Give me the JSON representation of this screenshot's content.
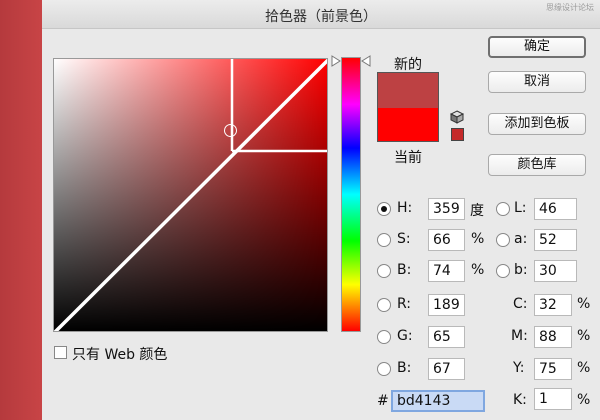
{
  "dialog": {
    "title": "拾色器（前景色）",
    "watermark": "思缘设计论坛"
  },
  "buttons": {
    "ok": "确定",
    "cancel": "取消",
    "add_to_swatches": "添加到色板",
    "color_libraries": "颜色库"
  },
  "preview": {
    "new_label": "新的",
    "current_label": "当前",
    "new_color": "#bd4143",
    "current_color": "#ff0000"
  },
  "hsb": {
    "h": {
      "label": "H:",
      "value": "359",
      "unit": "度",
      "selected": true
    },
    "s": {
      "label": "S:",
      "value": "66",
      "unit": "%"
    },
    "b": {
      "label": "B:",
      "value": "74",
      "unit": "%"
    }
  },
  "lab": {
    "l": {
      "label": "L:",
      "value": "46"
    },
    "a": {
      "label": "a:",
      "value": "52"
    },
    "b": {
      "label": "b:",
      "value": "30"
    }
  },
  "rgb": {
    "r": {
      "label": "R:",
      "value": "189"
    },
    "g": {
      "label": "G:",
      "value": "65"
    },
    "b": {
      "label": "B:",
      "value": "67"
    }
  },
  "cmyk": {
    "c": {
      "label": "C:",
      "value": "32",
      "unit": "%"
    },
    "m": {
      "label": "M:",
      "value": "88",
      "unit": "%"
    },
    "y": {
      "label": "Y:",
      "value": "75",
      "unit": "%"
    },
    "k": {
      "label": "K:",
      "value": "1",
      "unit": "%"
    }
  },
  "hex": {
    "label": "#",
    "value": "bd4143"
  },
  "web_only": {
    "label": "只有 Web 颜色",
    "checked": false
  },
  "colors": {
    "field_hue": "#ff0000",
    "hex_field_bg": "#c9daf5",
    "selected_red_swatch": "#c52a2a"
  },
  "icons": {
    "cube": "3d-cube-icon",
    "swatch": "color-swatch-icon",
    "slider_arrows": "triangle-arrow-icon"
  }
}
